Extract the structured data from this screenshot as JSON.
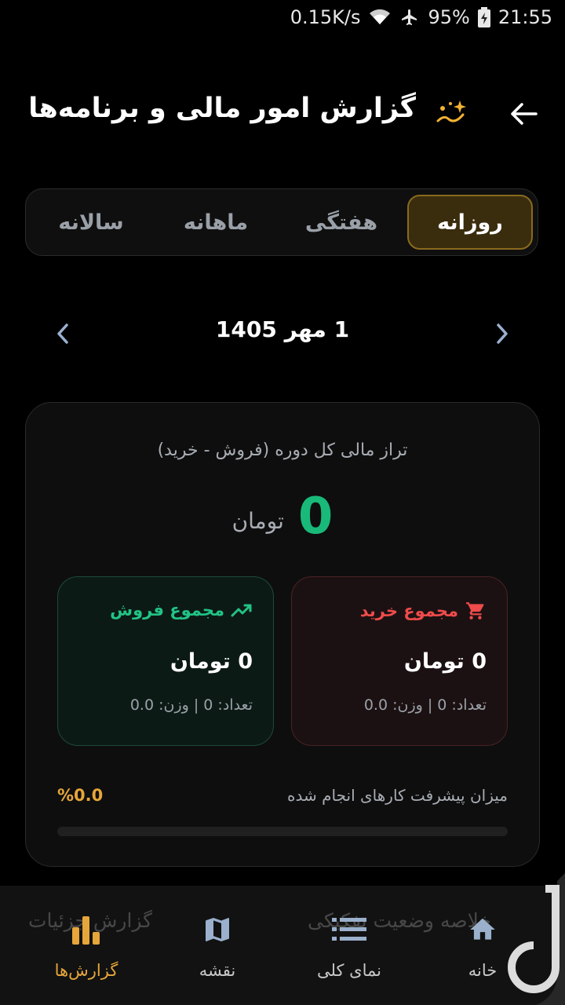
{
  "status_bar": {
    "speed": "0.15K/s",
    "battery": "95%",
    "time": "21:55"
  },
  "header": {
    "title": "گزارش امور مالی و برنامه‌ها"
  },
  "tabs": [
    {
      "label": "روزانه",
      "active": true
    },
    {
      "label": "هفتگی",
      "active": false
    },
    {
      "label": "ماهانه",
      "active": false
    },
    {
      "label": "سالانه",
      "active": false
    }
  ],
  "date": {
    "label": "1 مهر 1405"
  },
  "summary": {
    "subtitle": "تراز مالی کل دوره (فروش - خرید)",
    "balance_value": "0",
    "balance_unit": "تومان",
    "buy": {
      "title": "مجموع خرید",
      "amount": "0 تومان",
      "meta": "تعداد: 0 | وزن: 0.0"
    },
    "sell": {
      "title": "مجموع فروش",
      "amount": "0 تومان",
      "meta": "تعداد: 0 | وزن: 0.0"
    },
    "progress": {
      "label": "میزان پیشرفت کارهای انجام شده",
      "percent_text": "%0.0",
      "value": 0
    }
  },
  "bottom_nav": {
    "ghost_left": "گزارش جزئیات",
    "ghost_right": "خلاصه وضعیت تفکیکی",
    "items": [
      {
        "label": "خانه",
        "icon": "home-icon",
        "active": false
      },
      {
        "label": "نمای کلی",
        "icon": "list-icon",
        "active": false
      },
      {
        "label": "نقشه",
        "icon": "map-icon",
        "active": false
      },
      {
        "label": "گزارش‌ها",
        "icon": "bar-chart-icon",
        "active": true
      }
    ]
  },
  "colors": {
    "accent": "#e6a63a",
    "positive": "#19b97a",
    "negative": "#ef4b4b"
  }
}
